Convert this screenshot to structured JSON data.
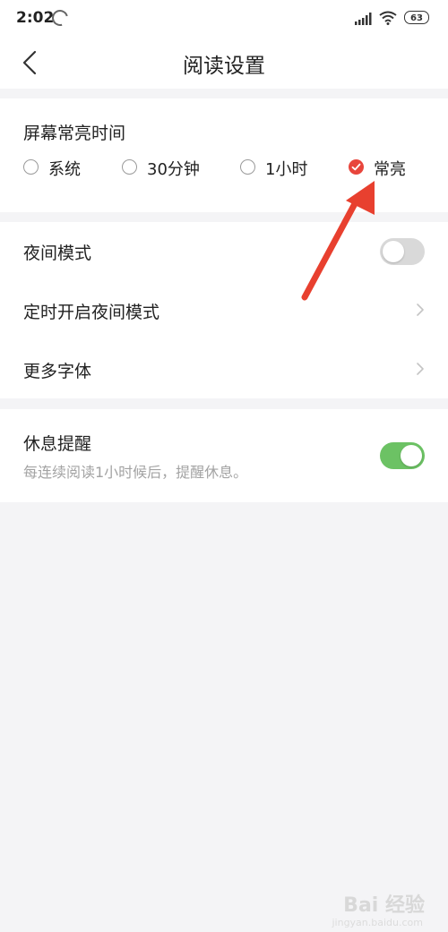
{
  "status_bar": {
    "time": "2:02",
    "battery": "63"
  },
  "header": {
    "title": "阅读设置"
  },
  "screen_on": {
    "label": "屏幕常亮时间",
    "options": [
      {
        "label": "系统",
        "selected": false
      },
      {
        "label": "30分钟",
        "selected": false
      },
      {
        "label": "1小时",
        "selected": false
      },
      {
        "label": "常亮",
        "selected": true
      }
    ]
  },
  "settings": {
    "night_mode": {
      "label": "夜间模式",
      "enabled": false
    },
    "timed_night_mode": {
      "label": "定时开启夜间模式"
    },
    "more_fonts": {
      "label": "更多字体"
    }
  },
  "rest_reminder": {
    "label": "休息提醒",
    "description": "每连续阅读1小时候后，提醒休息。",
    "enabled": true
  },
  "watermark": {
    "text": "Bai 经验",
    "sub": "jingyan.baidu.com"
  },
  "colors": {
    "accent_red": "#e8453c",
    "toggle_on": "#6cc264",
    "toggle_off": "#d9d9d9",
    "background": "#f4f4f6"
  }
}
